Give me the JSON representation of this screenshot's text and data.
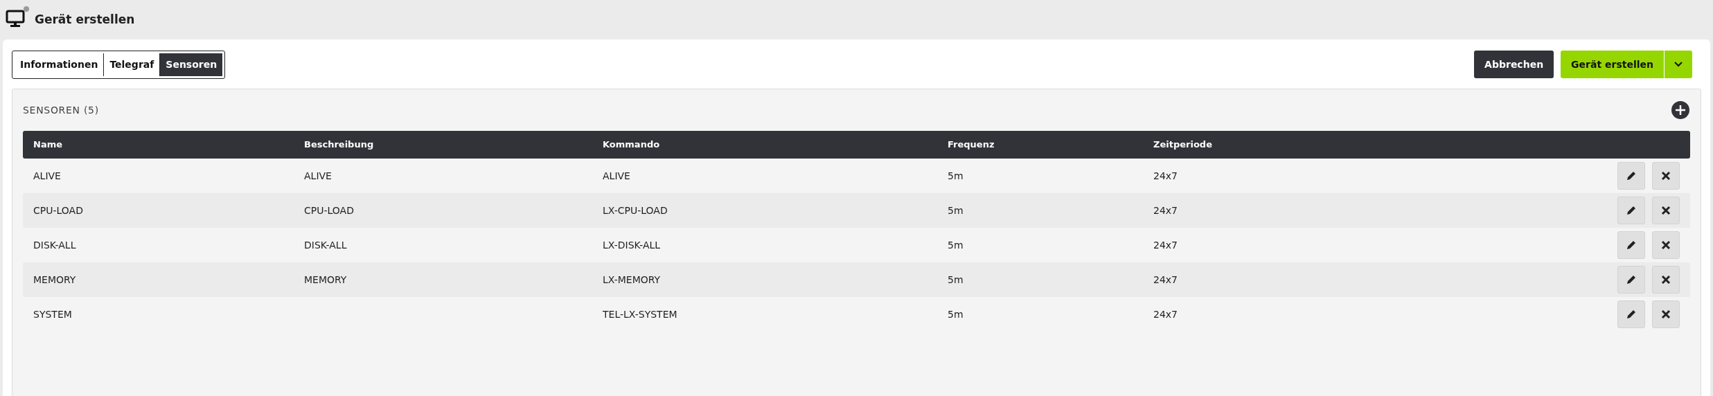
{
  "page": {
    "title": "Gerät erstellen"
  },
  "tabs": [
    {
      "label": "Informationen",
      "selected": false
    },
    {
      "label": "Telegraf",
      "selected": false
    },
    {
      "label": "Sensoren",
      "selected": true
    }
  ],
  "buttons": {
    "cancel": "Abbrechen",
    "create": "Gerät erstellen"
  },
  "section": {
    "title": "SENSOREN (5)"
  },
  "table": {
    "columns": [
      "Name",
      "Beschreibung",
      "Kommando",
      "Frequenz",
      "Zeitperiode"
    ],
    "rows": [
      [
        "ALIVE",
        "ALIVE",
        "ALIVE",
        "5m",
        "24x7"
      ],
      [
        "CPU-LOAD",
        "CPU-LOAD",
        "LX-CPU-LOAD",
        "5m",
        "24x7"
      ],
      [
        "DISK-ALL",
        "DISK-ALL",
        "LX-DISK-ALL",
        "5m",
        "24x7"
      ],
      [
        "MEMORY",
        "MEMORY",
        "LX-MEMORY",
        "5m",
        "24x7"
      ],
      [
        "SYSTEM",
        "",
        "TEL-LX-SYSTEM",
        "5m",
        "24x7"
      ]
    ]
  }
}
